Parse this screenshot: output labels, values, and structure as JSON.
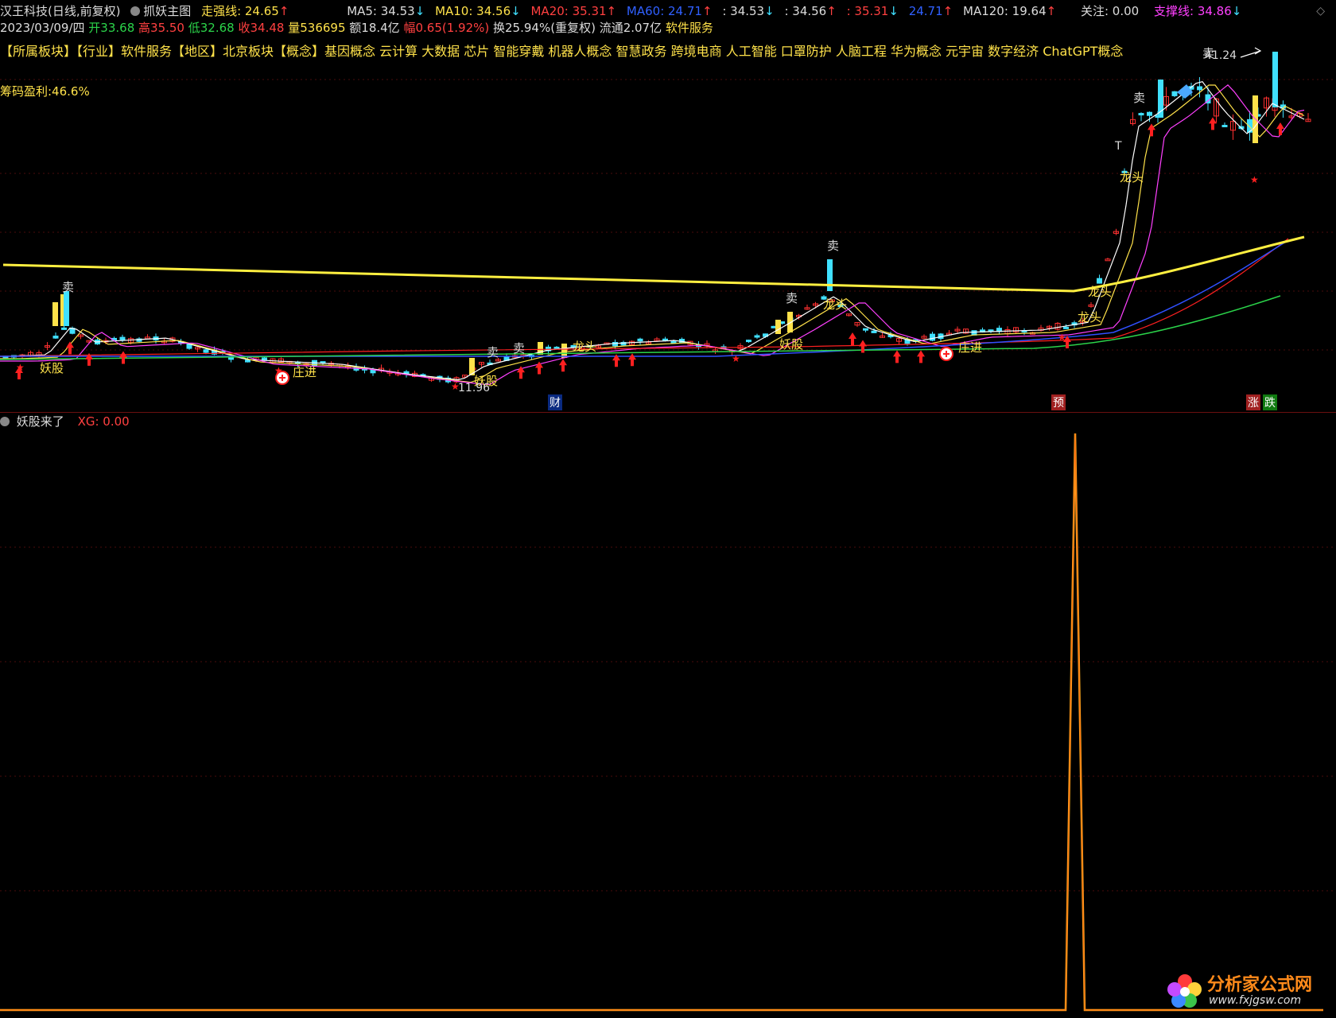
{
  "header": {
    "stock_name": "汉王科技(日线,前复权)",
    "chart_name": "抓妖主图",
    "strong_line": "走强线: 24.65",
    "ma5": "MA5: 34.53",
    "ma10": "MA10: 34.56",
    "ma20": "MA20: 35.31",
    "ma60": "MA60: 24.71",
    "v1": ": 34.53",
    "v2": ": 34.56",
    "v3": ": 35.31",
    "v4": "24.71",
    "ma120": "MA120: 19.64",
    "focus": "关注: 0.00",
    "support": "支撑线: 34.86"
  },
  "quote": {
    "date": "2023/03/09/四",
    "open": "开33.68",
    "high": "高35.50",
    "low": "低32.68",
    "close": "收34.48",
    "volume": "量536695",
    "amount": "额18.4亿",
    "change": "幅0.65(1.92%)",
    "turnover": "换25.94%(重复权)",
    "float": "流通2.07亿",
    "industry": "软件服务"
  },
  "concepts": "【所属板块】【行业】软件服务【地区】北京板块【概念】基因概念 云计算 大数据 芯片 智能穿戴 机器人概念 智慧政务 跨境电商 人工智能 口罩防护 人脑工程 华为概念 元宇宙 数字经济 ChatGPT概念",
  "chip_profit": "筹码盈利:46.6%",
  "markers": {
    "sell": "卖",
    "demon": "妖股",
    "dragon": "龙头",
    "dealer": "庄进",
    "low_price": "11.96",
    "high_price": "41.24",
    "t_mark": "T",
    "cai": "财",
    "yu": "预",
    "zhang": "涨",
    "die": "跌"
  },
  "sub_panel": {
    "title": "妖股来了",
    "xg": "XG: 0.00"
  },
  "logo": {
    "brand": "分析家公式网",
    "url": "www.fxjgsw.com"
  },
  "colors": {
    "up": "#ff3030",
    "down": "#40e0ff",
    "ma5": "#ffffff",
    "ma10": "#ffe24a",
    "ma20": "#ff40ff",
    "ma60": "#3050ff",
    "ma120": "#2bd44a",
    "support": "#ffef40",
    "sub_line": "#ffb020"
  }
}
